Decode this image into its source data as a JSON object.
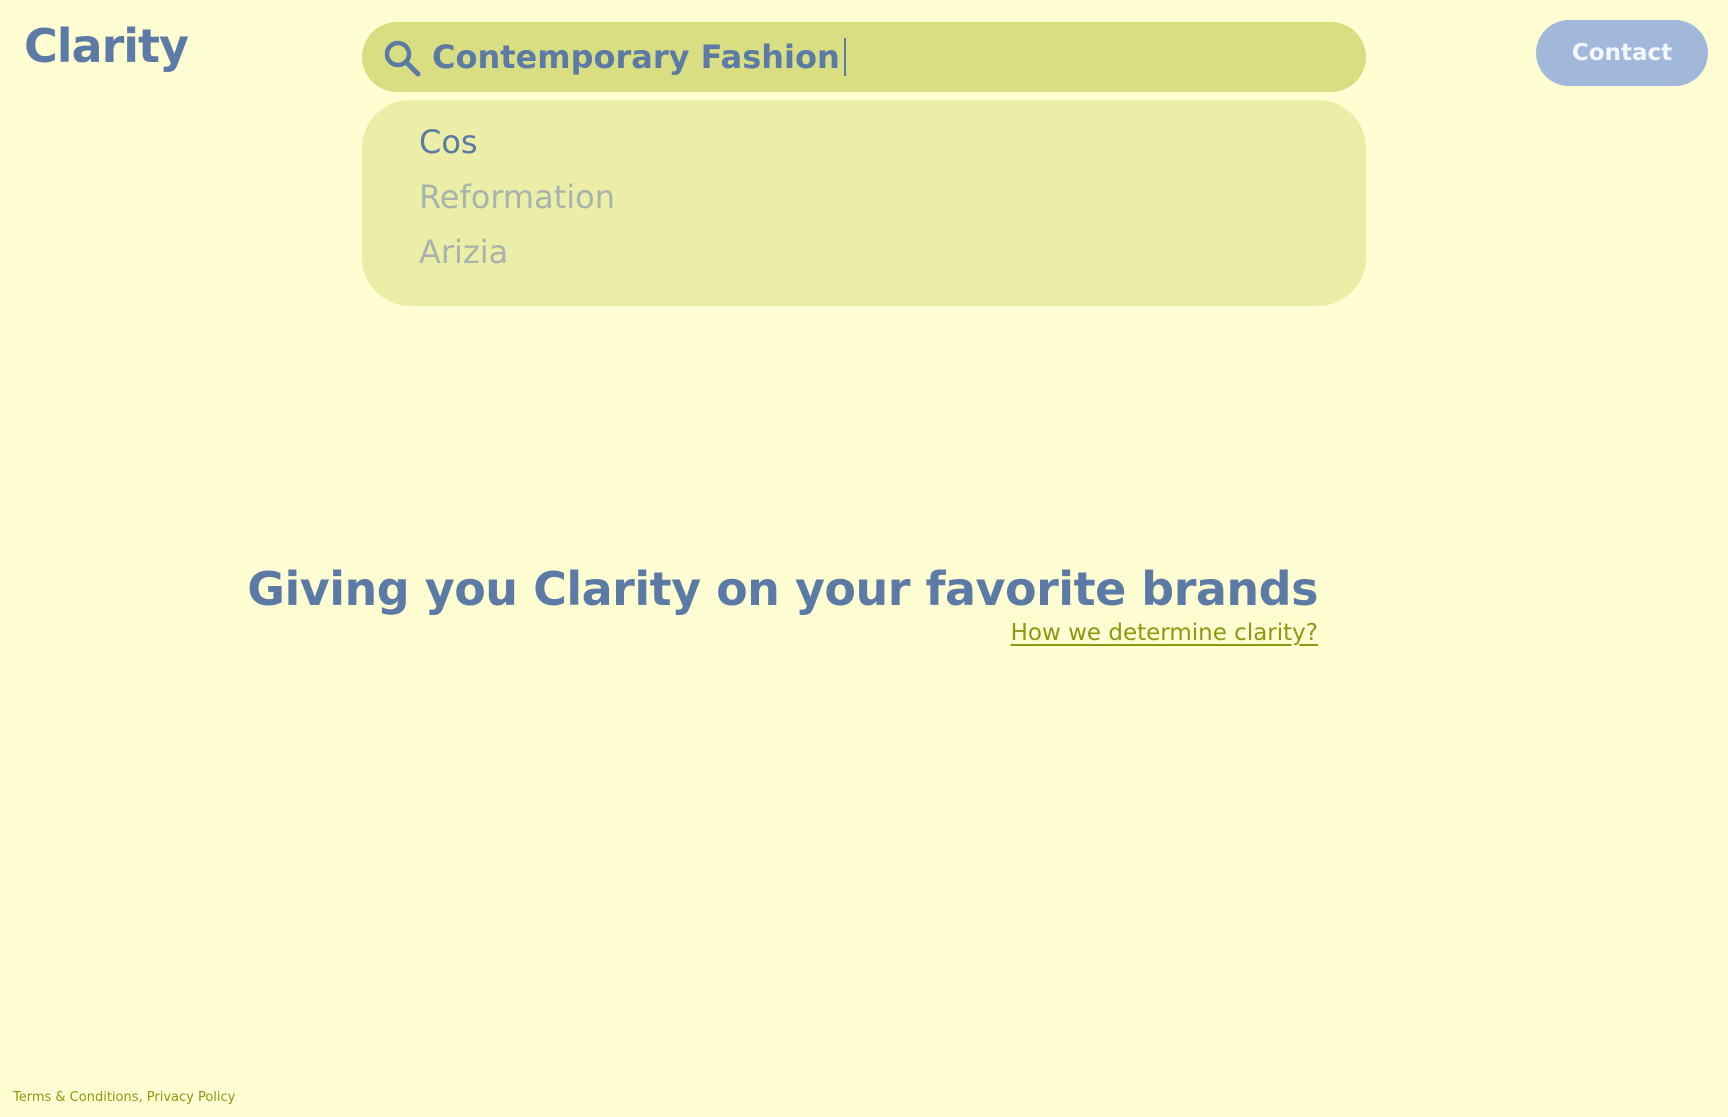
{
  "header": {
    "logo": "Clarity",
    "contact_label": "Contact"
  },
  "search": {
    "value": "Contemporary Fashion",
    "icon": "search-icon"
  },
  "dropdown": {
    "items": [
      {
        "label": "Cos",
        "active": true
      },
      {
        "label": "Reformation",
        "active": false
      },
      {
        "label": "Arizia",
        "active": false
      }
    ]
  },
  "hero": {
    "headline": "Giving you Clarity on your favorite brands",
    "link": "How we determine clarity?"
  },
  "footer": {
    "terms": "Terms & Conditions",
    "separator": ", ",
    "privacy": "Privacy Policy"
  },
  "colors": {
    "background": "#fefed2",
    "search_bg": "#d9de82",
    "dropdown_bg": "#eceea8",
    "primary_text": "#5b7aa5",
    "muted_text": "#a7b4ad",
    "link": "#8a9a12",
    "contact_button": "#a2b8db"
  }
}
